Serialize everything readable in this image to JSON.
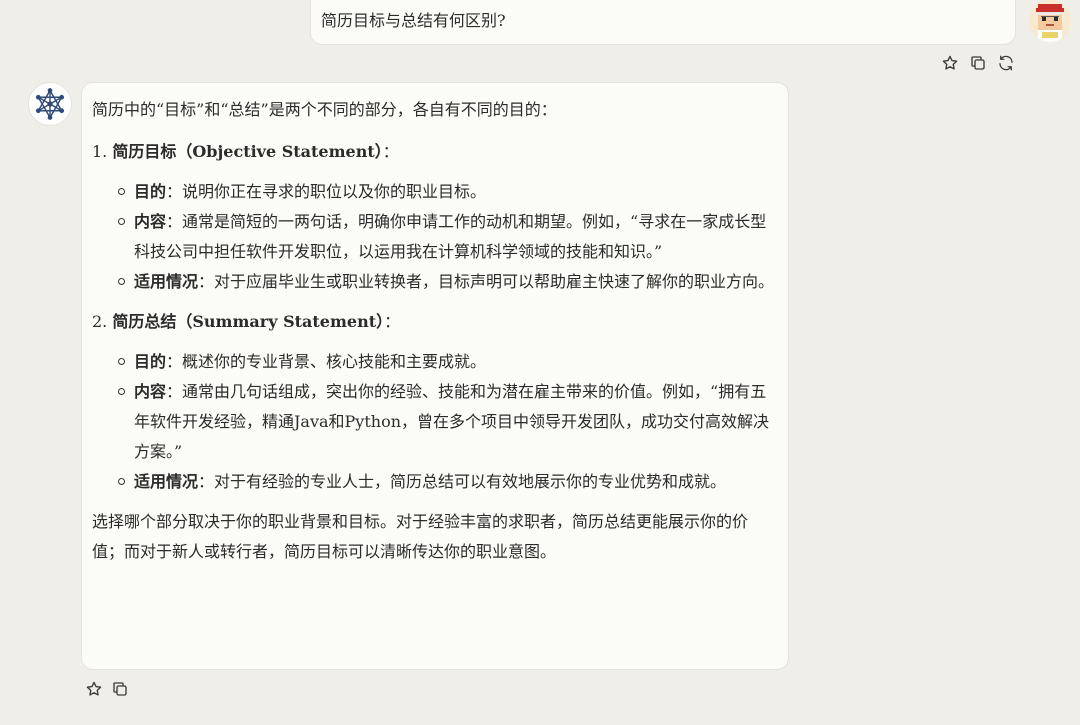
{
  "user_message": {
    "text": "简历目标与总结有何区别?"
  },
  "user_actions": {
    "icons": [
      "star-icon",
      "copy-icon",
      "regenerate-icon"
    ]
  },
  "assistant_message": {
    "intro": "简历中的“目标”和“总结”是两个不同的部分，各自有不同的目的：",
    "sections": [
      {
        "number": "1.",
        "title": "简历目标（Objective Statement）",
        "suffix": "：",
        "bullets": [
          {
            "label": "目的",
            "text": "：说明你正在寻求的职位以及你的职业目标。"
          },
          {
            "label": "内容",
            "text": "：通常是简短的一两句话，明确你申请工作的动机和期望。例如，“寻求在一家成长型科技公司中担任软件开发职位，以运用我在计算机科学领域的技能和知识。”"
          },
          {
            "label": "适用情况",
            "text": "：对于应届毕业生或职业转换者，目标声明可以帮助雇主快速了解你的职业方向。"
          }
        ]
      },
      {
        "number": "2.",
        "title": "简历总结（Summary Statement）",
        "suffix": "：",
        "bullets": [
          {
            "label": "目的",
            "text": "：概述你的专业背景、核心技能和主要成就。"
          },
          {
            "label": "内容",
            "text": "：通常由几句话组成，突出你的经验、技能和为潜在雇主带来的价值。例如，“拥有五年软件开发经验，精通Java和Python，曾在多个项目中领导开发团队，成功交付高效解决方案。”"
          },
          {
            "label": "适用情况",
            "text": "：对于有经验的专业人士，简历总结可以有效地展示你的专业优势和成就。"
          }
        ]
      }
    ],
    "outro": "选择哪个部分取决于你的职业背景和目标。对于经验丰富的求职者，简历总结更能展示你的价值；而对于新人或转行者，简历目标可以清晰传达你的职业意图。"
  },
  "assistant_actions": {
    "icons": [
      "star-icon",
      "copy-icon"
    ]
  },
  "colors": {
    "page_bg": "#efeee9",
    "bubble_bg": "#fbfbf7",
    "bubble_border": "#e4e3dc",
    "text": "#2b2b2b",
    "bot_logo": "#2d4a78"
  }
}
